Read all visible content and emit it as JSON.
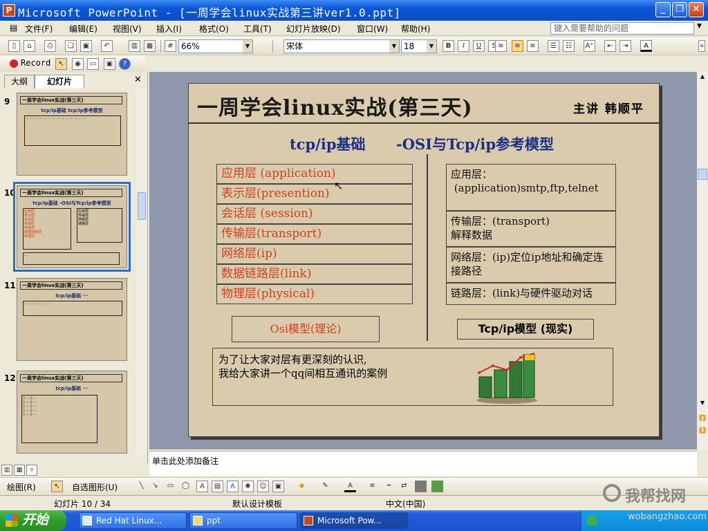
{
  "window": {
    "title": "Microsoft PowerPoint - [一周学会linux实战第三讲ver1.0.ppt]"
  },
  "menu": {
    "items": [
      "文件(F)",
      "编辑(E)",
      "视图(V)",
      "插入(I)",
      "格式(O)",
      "工具(T)",
      "幻灯片放映(D)",
      "窗口(W)",
      "帮助(H)"
    ],
    "help_placeholder": "键入需要帮助的问题"
  },
  "toolbar": {
    "zoom": "66%",
    "font": "宋体",
    "font_size": "18",
    "bold": "B",
    "italic": "I",
    "underline": "U",
    "shadow": "S",
    "record": "Record"
  },
  "panel": {
    "tab_outline": "大纲",
    "tab_slides": "幻灯片",
    "slides": [
      {
        "num": "9",
        "title": "一周学会linux实战(第三天)"
      },
      {
        "num": "10",
        "title": "一周学会linux实战(第三天)"
      },
      {
        "num": "11",
        "title": "一周学会linux实战(第三天)"
      },
      {
        "num": "12",
        "title": "一周学会linux实战(第三天)"
      }
    ]
  },
  "slide": {
    "title": "一周学会linux实战(第三天)",
    "lecturer": "主讲 韩顺平",
    "subtitle_left": "tcp/ip基础",
    "subtitle_right": "-OSI与Tcp/ip参考模型",
    "osi_layers": [
      "应用层 (application)",
      "表示层(presention)",
      "会话层 (session)",
      "传输层(transport)",
      "网络层(ip)",
      "数据链路层(link)",
      "物理层(physical)"
    ],
    "tcp_layers": [
      "应用层：\n (application)smtp,ftp,telnet",
      "传输层：(transport)\n解释数据",
      "网络层：(ip)定位ip地址和确定连接路径",
      "链路层：(link)与硬件驱动对话"
    ],
    "osi_label": "Osi模型(理论)",
    "tcp_label": "Tcp/ip模型 (现实)",
    "bottom_line1": "为了让大家对层有更深刻的认识,",
    "bottom_line2": "我给大家讲一个qq间相互通讯的案例"
  },
  "notes": {
    "placeholder": "单击此处添加备注"
  },
  "drawbar": {
    "draw": "绘图(R)",
    "autoshapes": "自选图形(U)"
  },
  "status": {
    "slide_pos": "幻灯片 10 / 34",
    "design": "默认设计模板",
    "language": "中文(中国)"
  },
  "taskbar": {
    "start": "开始",
    "tasks": [
      "Red Hat Linux...",
      "ppt",
      "Microsoft Pow..."
    ]
  },
  "watermark": {
    "main": "我帮找网",
    "url": "wobangzhao.com"
  }
}
